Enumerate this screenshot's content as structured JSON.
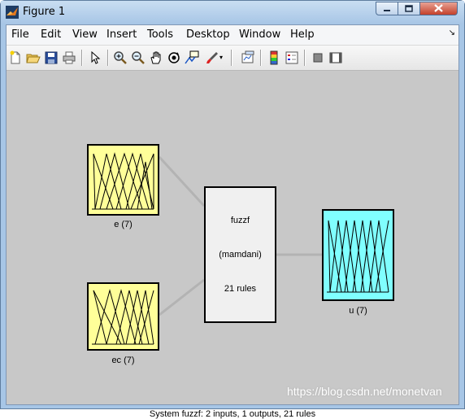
{
  "window": {
    "title": "Figure 1",
    "colors": {
      "frame": "#a7c6e6",
      "canvas": "#c8c8c8",
      "input_fill": "#ffff99",
      "output_fill": "#80ffff",
      "system_fill": "#f0f0f0"
    }
  },
  "icons": [
    "matlab-figure-icon",
    "minimize-icon",
    "maximize-icon",
    "close-icon"
  ],
  "menu": {
    "items": [
      "File",
      "Edit",
      "View",
      "Insert",
      "Tools",
      "Desktop",
      "Window",
      "Help"
    ]
  },
  "toolbar": {
    "buttons": [
      "new-figure-icon",
      "open-icon",
      "save-icon",
      "print-icon",
      "pointer-icon",
      "zoom-in-icon",
      "zoom-out-icon",
      "pan-icon",
      "rotate-3d-icon",
      "data-cursor-icon",
      "brush-icon",
      "link-plot-icon",
      "colorbar-icon",
      "legend-icon",
      "hide-plot-tools-icon",
      "show-plot-tools-icon"
    ]
  },
  "diagram": {
    "input1": {
      "label": "e (7)"
    },
    "input2": {
      "label": "ec (7)"
    },
    "system": {
      "name": "fuzzf",
      "type": "(mamdani)",
      "rules": "21 rules"
    },
    "output": {
      "label": "u (7)"
    },
    "status": "System fuzzf: 2 inputs, 1 outputs, 21 rules"
  },
  "watermark": "https://blog.csdn.net/monetvan"
}
